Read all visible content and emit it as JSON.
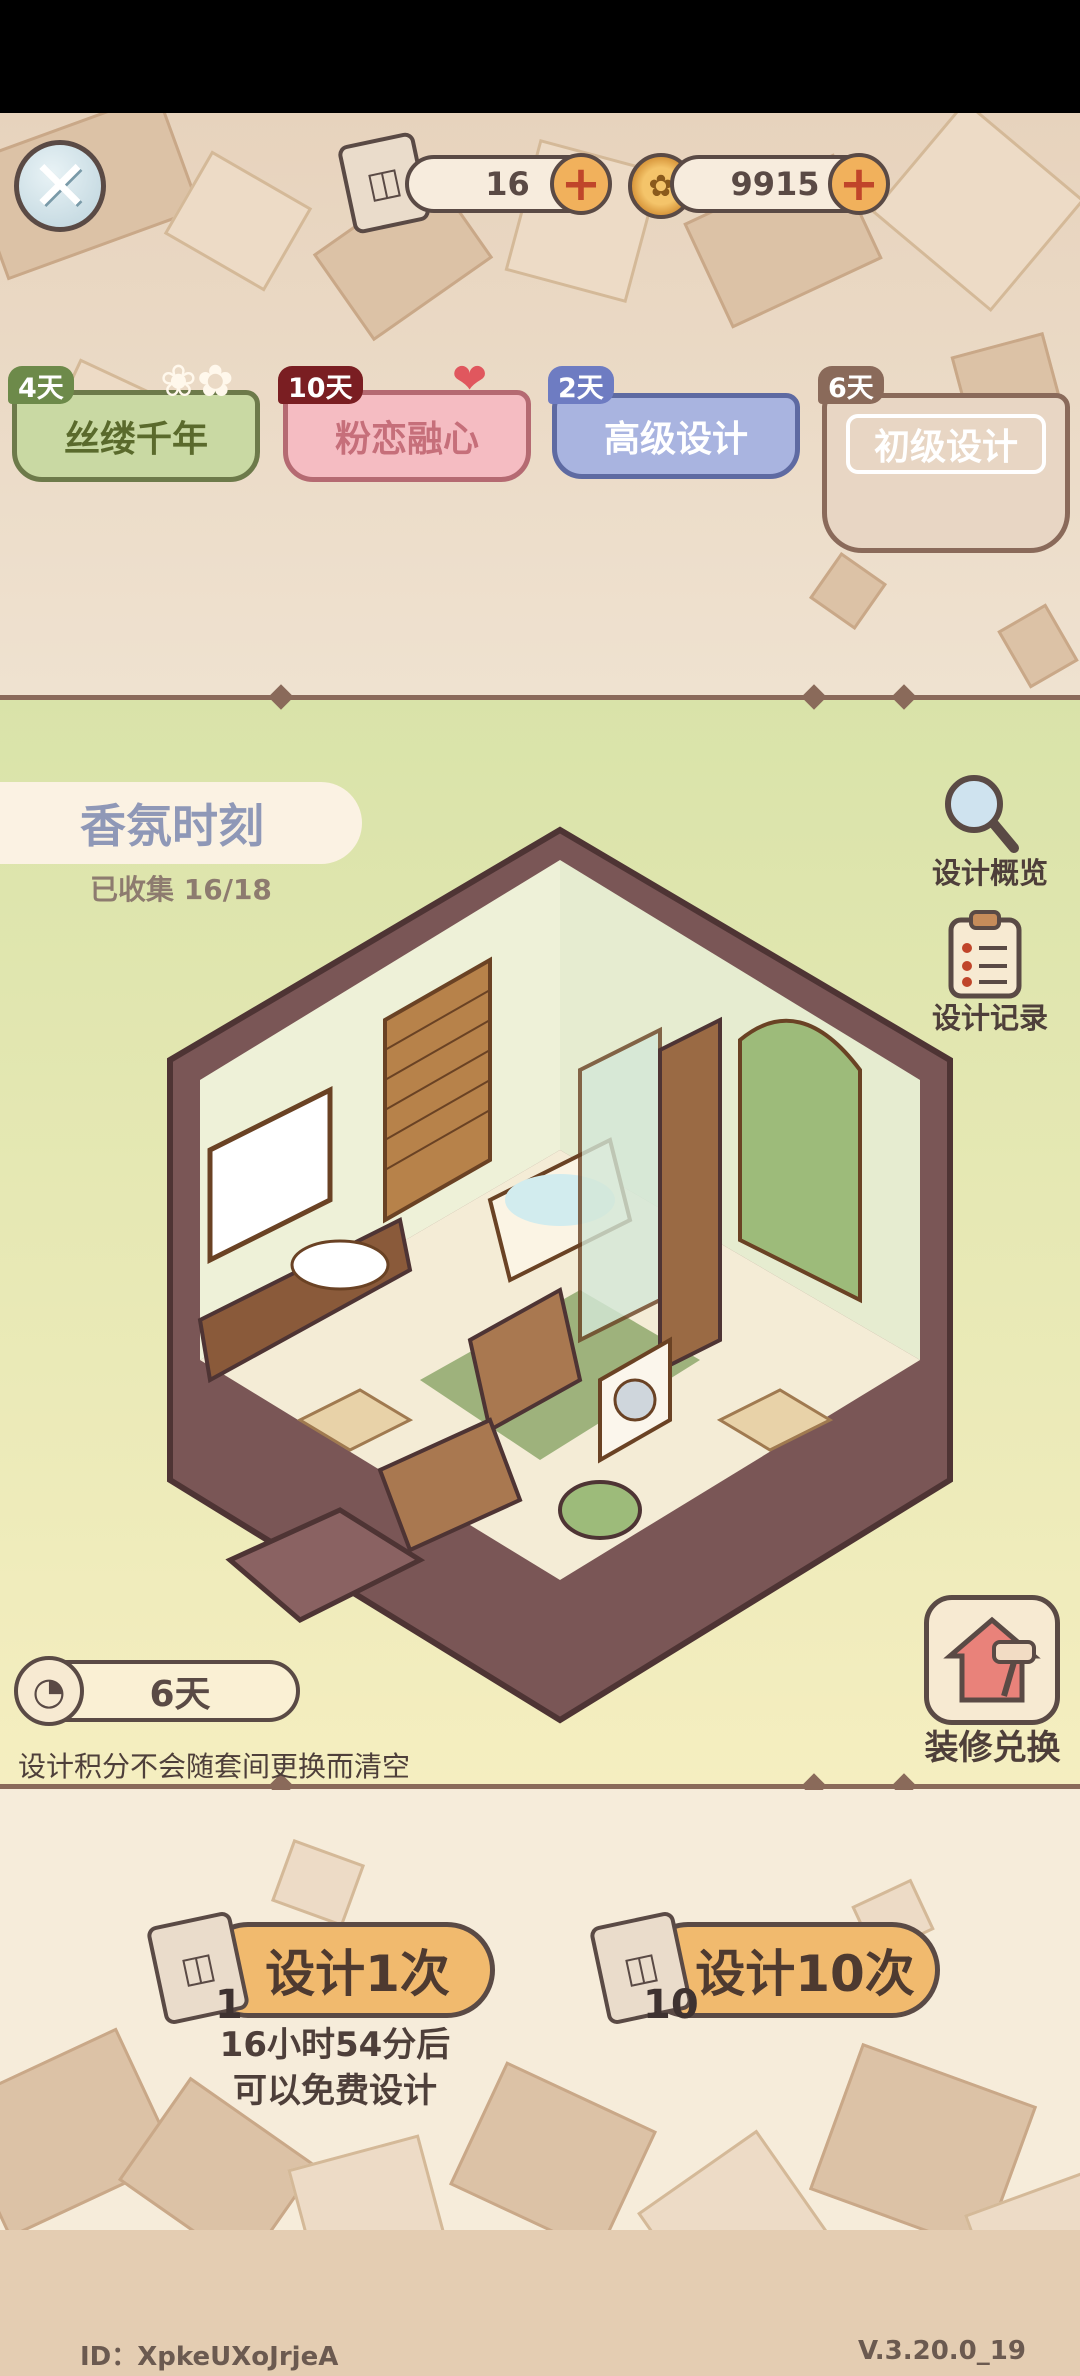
{
  "currency": {
    "scrolls_value": "16",
    "coins_value": "9915"
  },
  "tabs": [
    {
      "badge": "4天",
      "label": "丝缕千年"
    },
    {
      "badge": "10天",
      "label": "粉恋融心"
    },
    {
      "badge": "2天",
      "label": "高级设计"
    },
    {
      "badge": "6天",
      "label": "初级设计"
    }
  ],
  "room": {
    "title": "香氛时刻",
    "collected": "已收集 16/18"
  },
  "side_buttons": {
    "overview": "设计概览",
    "records": "设计记录",
    "exchange": "装修兑换"
  },
  "timer": {
    "value": "6天",
    "note": "设计积分不会随套间更换而清空"
  },
  "draw": {
    "single_label": "设计1次",
    "single_cost": "1",
    "ten_label": "设计10次",
    "ten_cost": "10",
    "free_line1": "16小时54分后",
    "free_line2": "可以免费设计"
  },
  "footer": {
    "id": "ID：XpkeUXoJrjeA",
    "version": "V.3.20.0_19"
  },
  "colors": {
    "outline": "#5a4a45",
    "accent_orange": "#f1ba6e",
    "tab_green": "#c9d9a3",
    "tab_pink": "#f5bcc2",
    "tab_blue": "#a9b4e0",
    "tab_beige": "#e8d6c4"
  }
}
